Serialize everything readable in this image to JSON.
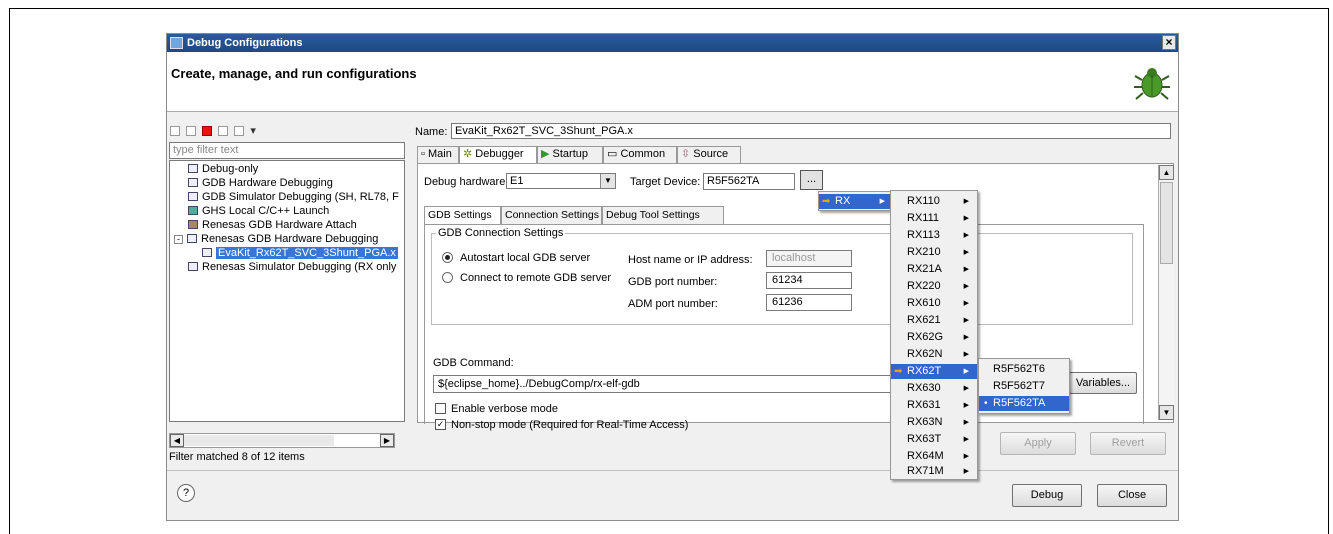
{
  "window": {
    "title": "Debug Configurations",
    "heading": "Create, manage, and run configurations"
  },
  "left": {
    "filter_placeholder": "type filter text",
    "tree": [
      {
        "label": "Debug-only"
      },
      {
        "label": "GDB Hardware Debugging"
      },
      {
        "label": "GDB Simulator Debugging (SH, RL78, F"
      },
      {
        "label": "GHS Local C/C++ Launch"
      },
      {
        "label": "Renesas GDB Hardware Attach"
      },
      {
        "label": "Renesas GDB Hardware Debugging"
      },
      {
        "label": "EvaKit_Rx62T_SVC_3Shunt_PGA.x"
      },
      {
        "label": "Renesas Simulator Debugging (RX only"
      }
    ],
    "matched": "Filter matched 8 of 12 items"
  },
  "right": {
    "name_label": "Name:",
    "name_value": "EvaKit_Rx62T_SVC_3Shunt_PGA.x",
    "tabs": [
      "Main",
      "Debugger",
      "Startup",
      "Common",
      "Source"
    ],
    "debug_hw_label": "Debug hardware:",
    "debug_hw_value": "E1",
    "target_label": "Target Device:",
    "target_value": "R5F562TA",
    "browse_label": "...",
    "subtabs": [
      "GDB Settings",
      "Connection Settings",
      "Debug Tool Settings"
    ],
    "group_label": "GDB Connection Settings",
    "radio_auto": "Autostart local GDB server",
    "radio_remote": "Connect to remote GDB server",
    "host_label": "Host name or IP address:",
    "host_value": "localhost",
    "port_label": "GDB port number:",
    "port_value": "61234",
    "adm_label": "ADM port number:",
    "adm_value": "61236",
    "cmd_label": "GDB Command:",
    "cmd_value": "${eclipse_home}../DebugComp/rx-elf-gdb",
    "variables_label": "Variables...",
    "verbose_label": "Enable verbose mode",
    "nonstop_label": "Non-stop mode (Required for Real-Time Access)",
    "apply_label": "Apply",
    "revert_label": "Revert"
  },
  "bottom": {
    "help": "?",
    "debug_label": "Debug",
    "close_label": "Close"
  },
  "menus": {
    "level1": [
      "RX"
    ],
    "level2": [
      "RX110",
      "RX111",
      "RX113",
      "RX210",
      "RX21A",
      "RX220",
      "RX610",
      "RX621",
      "RX62G",
      "RX62N",
      "RX62T",
      "RX630",
      "RX631",
      "RX63N",
      "RX63T",
      "RX64M",
      "RX71M"
    ],
    "level2_highlight": "RX62T",
    "level3": [
      "R5F562T6",
      "R5F562T7",
      "R5F562TA"
    ],
    "level3_selected": "R5F562TA"
  }
}
